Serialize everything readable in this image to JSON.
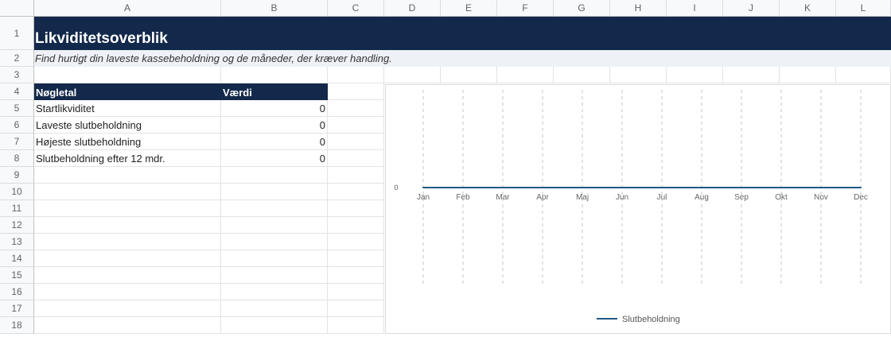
{
  "sheet": {
    "columns": [
      "A",
      "B",
      "C",
      "D",
      "E",
      "F",
      "G",
      "H",
      "I",
      "J",
      "K",
      "L"
    ],
    "rows": [
      "1",
      "2",
      "3",
      "4",
      "5",
      "6",
      "7",
      "8",
      "9",
      "10",
      "11",
      "12",
      "13",
      "14",
      "15",
      "16",
      "17",
      "18"
    ]
  },
  "title": "Likviditetsoverblik",
  "subtitle": "Find hurtigt din laveste kassebeholdning og de måneder, der kræver handling.",
  "kpi_table": {
    "headers": [
      "Nøgletal",
      "Værdi"
    ],
    "rows": [
      {
        "label": "Startlikviditet",
        "value": "0"
      },
      {
        "label": "Laveste slutbeholdning",
        "value": "0"
      },
      {
        "label": "Højeste slutbeholdning",
        "value": "0"
      },
      {
        "label": "Slutbeholdning efter 12 mdr.",
        "value": "0"
      }
    ]
  },
  "colors": {
    "header_bg": "#13294b",
    "subtitle_bg": "#eef1f5",
    "series_line": "#1f5a85"
  },
  "chart_data": {
    "type": "line",
    "categories": [
      "Jan",
      "Feb",
      "Mar",
      "Apr",
      "Maj",
      "Jun",
      "Jul",
      "Aug",
      "Sep",
      "Okt",
      "Nov",
      "Dec"
    ],
    "series": [
      {
        "name": "Slutbeholdning",
        "values": [
          0,
          0,
          0,
          0,
          0,
          0,
          0,
          0,
          0,
          0,
          0,
          0
        ]
      }
    ],
    "y_ticks": [
      "0"
    ],
    "grid": "vertical dashed",
    "legend": "bottom"
  }
}
